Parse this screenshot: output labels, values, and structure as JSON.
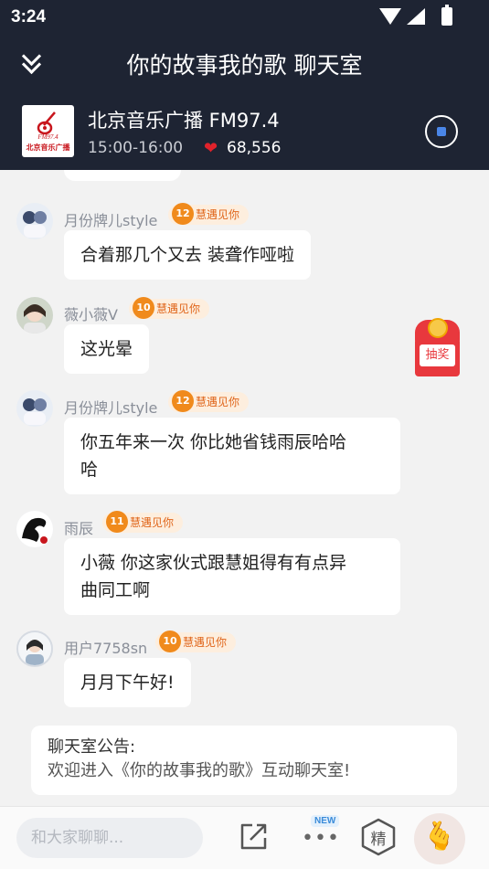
{
  "status_bar": {
    "time": "3:24"
  },
  "header": {
    "title": "你的故事我的歌 聊天室",
    "station": {
      "name": "北京音乐广播 FM97.4",
      "time": "15:00-16:00",
      "likes": "68,556",
      "logo_text_1": "FM97.4",
      "logo_text_2": "北京音乐广播"
    }
  },
  "messages": [
    {
      "nick": "月份牌儿style",
      "level": "12",
      "badge": "慧遇见你",
      "lines": [
        "合着那几个又去 装聋作哑啦"
      ]
    },
    {
      "nick": "薇小薇V",
      "level": "10",
      "badge": "慧遇见你",
      "lines": [
        "这光晕"
      ]
    },
    {
      "nick": "月份牌儿style",
      "level": "12",
      "badge": "慧遇见你",
      "lines": [
        "你五年来一次 你比她省钱雨辰哈哈",
        "哈"
      ]
    },
    {
      "nick": "雨辰",
      "level": "11",
      "badge": "慧遇见你",
      "lines": [
        "小薇 你这家伙式跟慧姐得有有点异",
        "曲同工啊"
      ]
    },
    {
      "nick": "用户7758sn",
      "level": "10",
      "badge": "慧遇见你",
      "lines": [
        "月月下午好!"
      ]
    }
  ],
  "lottery": {
    "label": "抽奖"
  },
  "notice": {
    "title": "聊天室公告:",
    "text": "欢迎进入《你的故事我的歌》互动聊天室!"
  },
  "bottom_bar": {
    "input_placeholder": "和大家聊聊...",
    "new_badge": "NEW",
    "featured_label": "精",
    "gesture_icon": "finger-heart-icon"
  }
}
